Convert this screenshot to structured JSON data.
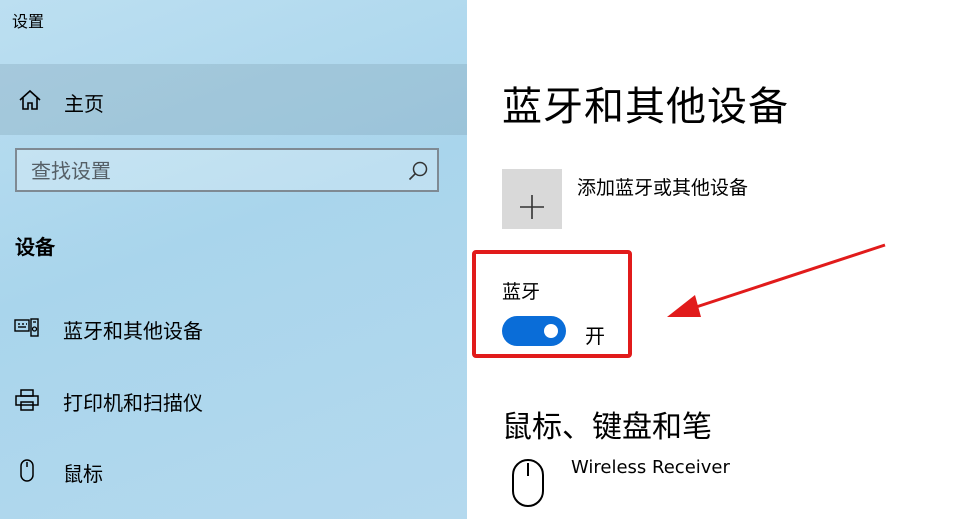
{
  "window": {
    "title": "设置"
  },
  "nav": {
    "home_label": "主页",
    "search": {
      "placeholder": "查找设置",
      "value": ""
    },
    "section_heading": "设备",
    "items": [
      {
        "label": "蓝牙和其他设备",
        "icon": "keyboard-device-icon"
      },
      {
        "label": "打印机和扫描仪",
        "icon": "printer-icon"
      },
      {
        "label": "鼠标",
        "icon": "mouse-icon"
      }
    ]
  },
  "content": {
    "page_title": "蓝牙和其他设备",
    "add_device_label": "添加蓝牙或其他设备",
    "bluetooth": {
      "label": "蓝牙",
      "state_label": "开",
      "on": true
    },
    "section2_heading": "鼠标、键盘和笔",
    "devices": [
      {
        "name": "Wireless Receiver",
        "icon": "mouse-icon"
      }
    ]
  },
  "colors": {
    "nav_background": "#b4d9ee",
    "toggle_on": "#0a6dd8",
    "highlight_red": "#e11b1b",
    "add_button_bg": "#d9d9d9"
  }
}
